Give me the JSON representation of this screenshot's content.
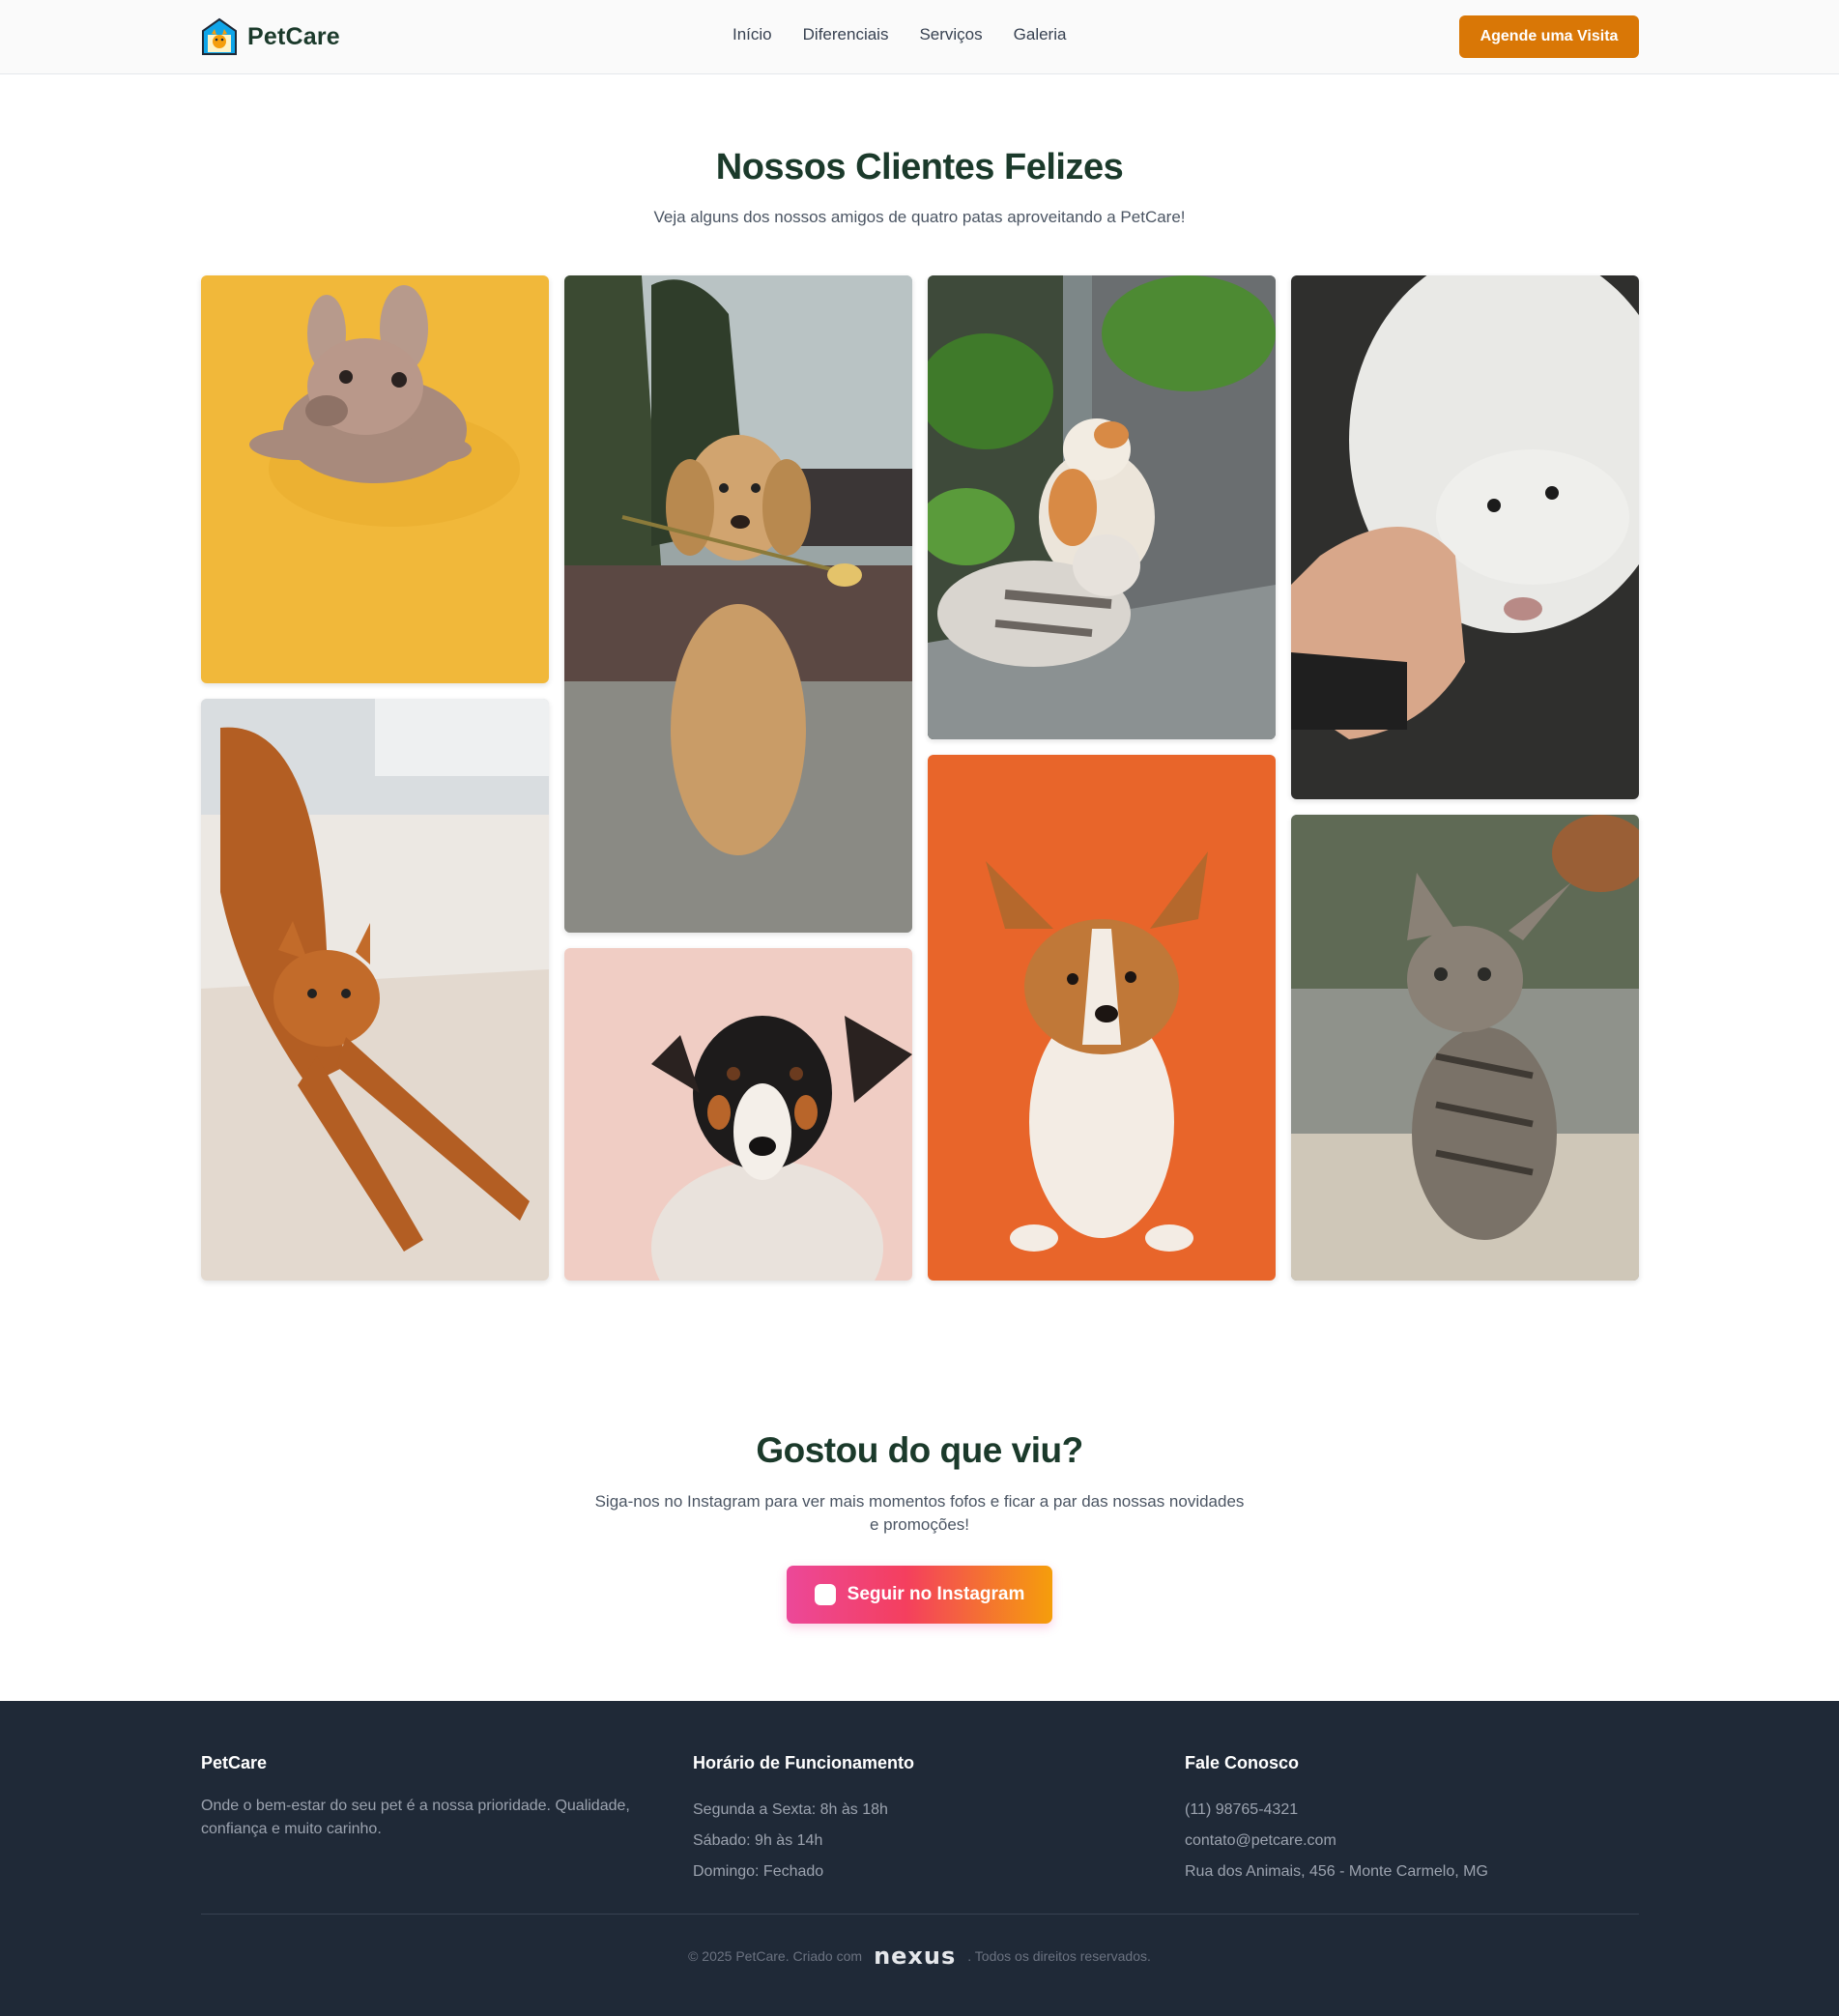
{
  "header": {
    "brand": "PetCare",
    "nav": [
      "Início",
      "Diferenciais",
      "Serviços",
      "Galeria"
    ],
    "cta": "Agende uma Visita"
  },
  "gallery": {
    "title": "Nossos Clientes Felizes",
    "subtitle": "Veja alguns dos nossos amigos de quatro patas aproveitando a PetCare!"
  },
  "social": {
    "title": "Gostou do que viu?",
    "text": "Siga-nos no Instagram para ver mais momentos fofos e ficar a par das nossas novidades e promoções!",
    "button": "Seguir no Instagram"
  },
  "footer": {
    "about_title": "PetCare",
    "about_text": "Onde o bem-estar do seu pet é a nossa prioridade. Qualidade, confiança e muito carinho.",
    "hours_title": "Horário de Funcionamento",
    "hours": [
      "Segunda a Sexta: 8h às 18h",
      "Sábado: 9h às 14h",
      "Domingo: Fechado"
    ],
    "contact_title": "Fale Conosco",
    "contact": [
      "(11) 98765-4321",
      "contato@petcare.com",
      "Rua dos Animais, 456 - Monte Carmelo, MG"
    ],
    "copyright_prefix": "© 2025 PetCare. Criado com",
    "made_with": "nexus",
    "copyright_suffix": ". Todos os direitos reservados."
  },
  "colors": {
    "brand_green": "#1b3a2b",
    "accent_orange": "#d97706",
    "footer_bg": "#1f2937"
  }
}
